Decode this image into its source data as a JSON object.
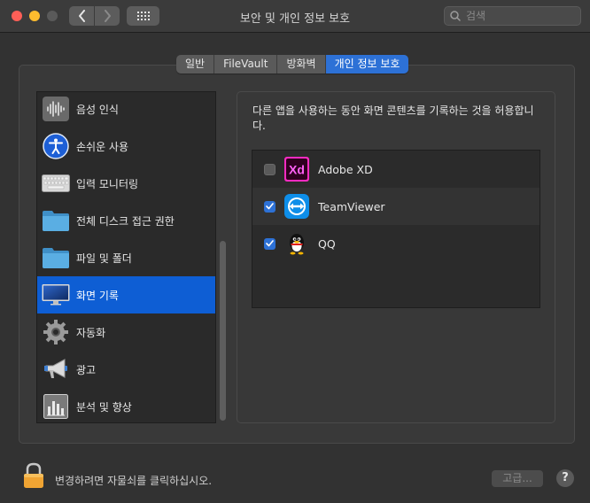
{
  "window": {
    "title": "보안 및 개인 정보 보호",
    "search_placeholder": "검색"
  },
  "tabs": [
    {
      "label": "일반",
      "active": false
    },
    {
      "label": "FileVault",
      "active": false
    },
    {
      "label": "방화벽",
      "active": false
    },
    {
      "label": "개인 정보 보호",
      "active": true
    }
  ],
  "sidebar": {
    "items": [
      {
        "label": "음성 인식",
        "icon": "speech-recognition-icon"
      },
      {
        "label": "손쉬운 사용",
        "icon": "accessibility-icon"
      },
      {
        "label": "입력 모니터링",
        "icon": "keyboard-icon"
      },
      {
        "label": "전체 디스크 접근 권한",
        "icon": "folder-icon"
      },
      {
        "label": "파일 및 폴더",
        "icon": "folder-icon"
      },
      {
        "label": "화면 기록",
        "icon": "display-icon",
        "selected": true
      },
      {
        "label": "자동화",
        "icon": "gear-icon"
      },
      {
        "label": "광고",
        "icon": "megaphone-icon"
      },
      {
        "label": "분석 및 향상",
        "icon": "analytics-icon"
      }
    ]
  },
  "content": {
    "description": "다른 앱을 사용하는 동안 화면 콘텐츠를 기록하는 것을 허용합니다.",
    "apps": [
      {
        "name": "Adobe XD",
        "checked": false,
        "icon": "adobe-xd-icon"
      },
      {
        "name": "TeamViewer",
        "checked": true,
        "icon": "teamviewer-icon"
      },
      {
        "name": "QQ",
        "checked": true,
        "icon": "qq-icon"
      }
    ]
  },
  "footer": {
    "lock_text": "변경하려면 자물쇠를 클릭하십시오.",
    "advanced_label": "고급...",
    "help_label": "?"
  },
  "colors": {
    "accent": "#2d71d6",
    "selection": "#0e5ed4",
    "close": "#fe5f57",
    "minimize": "#febc2e"
  }
}
